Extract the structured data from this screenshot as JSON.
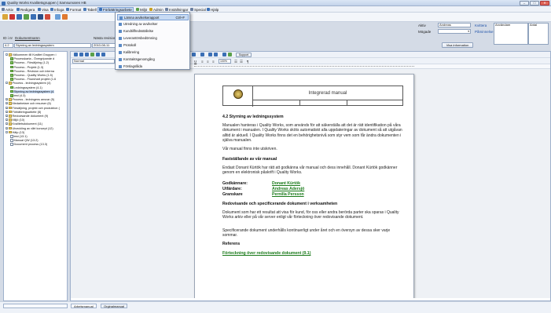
{
  "window": {
    "title": "Quality Works Kvalitetsgruppen | Samsurvaren HB",
    "controls": [
      "–",
      "□",
      "✕"
    ]
  },
  "menubar": {
    "items": [
      {
        "label": "Arkiv",
        "icon": "file-icon",
        "color": "#6b7fa0"
      },
      {
        "label": "Redigera",
        "icon": "edit-icon",
        "color": "#4a7ab8"
      },
      {
        "label": "Visa",
        "icon": "view-icon",
        "color": "#4a7ab8"
      },
      {
        "label": "Infoga",
        "icon": "insert-icon",
        "color": "#4a7ab8"
      },
      {
        "label": "Format",
        "icon": "format-icon",
        "color": "#4a7ab8"
      },
      {
        "label": "Tabell",
        "icon": "table-icon",
        "color": "#4a7ab8"
      },
      {
        "label": "Förbättringsarbete",
        "icon": "improvement-icon",
        "color": "#3a6fb5"
      },
      {
        "label": "Miljö",
        "icon": "environment-icon",
        "color": "#5aa04a"
      },
      {
        "label": "Admin",
        "icon": "admin-icon",
        "color": "#c8a020"
      },
      {
        "label": "Inställningar",
        "icon": "settings-icon",
        "color": "#6b7fa0"
      },
      {
        "label": "Special",
        "icon": "special-icon",
        "color": "#6b7fa0"
      },
      {
        "label": "Hjälp",
        "icon": "help-icon",
        "color": "#3a6fb5"
      }
    ]
  },
  "dropdown": {
    "items": [
      {
        "label": "Lämna avvikelserapport",
        "shortcut": "Ctrl+F"
      },
      {
        "label": "Utredning av avvikelser",
        "shortcut": ""
      },
      {
        "label": "Kundtillfredsställelse",
        "shortcut": ""
      },
      {
        "label": "Leverantörsbedömning",
        "shortcut": ""
      },
      {
        "label": "Protokoll",
        "shortcut": ""
      },
      {
        "label": "Kalibrering",
        "shortcut": ""
      },
      {
        "label": "Kontraktsgenomgång",
        "shortcut": ""
      },
      {
        "label": "Förslagslåda",
        "shortcut": ""
      }
    ]
  },
  "form": {
    "id_label": "ID i nr",
    "doc_label": "Dokumentnamn",
    "next_label": "Nästa revision",
    "id_value": "4.2",
    "doc_value": "Styrning av ledningssystem",
    "date_value": "2010-08-11",
    "aktiv_label": "Aktiv",
    "aktiv_value": "Andreas",
    "mogade_label": "Mögade",
    "kvitera_label": "Kvittera",
    "paminnelse_label": "Påminnelse",
    "anvandare_label": "Användare",
    "antal_label": "Antal",
    "show_info_button": "Visa information"
  },
  "tree": {
    "items": [
      {
        "label": "Välkommen till Kvalitet Gruppen i",
        "kind": "fold",
        "exp": "-",
        "indent": 0
      },
      {
        "label": "Processkarta - Övergripande d",
        "kind": "chk",
        "exp": "",
        "indent": 1
      },
      {
        "label": "Process - Försäljning (1.2)",
        "kind": "chk",
        "exp": "",
        "indent": 1
      },
      {
        "label": "Process - Projekt (1.3)",
        "kind": "chk",
        "exp": "",
        "indent": 1
      },
      {
        "label": "Process - Revision och interna",
        "kind": "chk",
        "exp": "",
        "indent": 1
      },
      {
        "label": "Process - Quality Works (1.5)",
        "kind": "chk",
        "exp": "",
        "indent": 1
      },
      {
        "label": "Process - Flowchart projekt (1.6",
        "kind": "chk",
        "exp": "",
        "indent": 1
      },
      {
        "label": "Process - ledningssystem (4)",
        "kind": "fold",
        "exp": "-",
        "indent": 0
      },
      {
        "label": "Ledningssystem (4.1)",
        "kind": "chk",
        "exp": "",
        "indent": 1
      },
      {
        "label": "Styrning av ledningssystem (4.",
        "kind": "chk",
        "exp": "",
        "indent": 1
      },
      {
        "label": "test (4.3)",
        "kind": "chk",
        "exp": "",
        "indent": 1
      },
      {
        "label": "Process - ledningens ansvar (5)",
        "kind": "fold",
        "exp": "+",
        "indent": 0
      },
      {
        "label": "Medarbetare och resurser (6)",
        "kind": "fold",
        "exp": "+",
        "indent": 0
      },
      {
        "label": "Försäljning, projekt och produktion (",
        "kind": "fold",
        "exp": "+",
        "indent": 0
      },
      {
        "label": "Förbättringsarbete (8)",
        "kind": "fold",
        "exp": "+",
        "indent": 0
      },
      {
        "label": "Redovisande dokument (9)",
        "kind": "fold",
        "exp": "+",
        "indent": 0
      },
      {
        "label": "Miljö (10)",
        "kind": "fold",
        "exp": "+",
        "indent": 0
      },
      {
        "label": "Kvalitetsdokument (11)",
        "kind": "fold",
        "exp": "+",
        "indent": 0
      },
      {
        "label": "Utveckling av vårt koncept (12)",
        "kind": "fold",
        "exp": "+",
        "indent": 0
      },
      {
        "label": "Hälp (13)",
        "kind": "fold",
        "exp": "-",
        "indent": 0
      },
      {
        "label": "test (13.1)",
        "kind": "doc",
        "exp": "",
        "indent": 1
      },
      {
        "label": "Manual QW (13.2)",
        "kind": "doc",
        "exp": "",
        "indent": 1
      },
      {
        "label": "Document process (13.3)",
        "kind": "doc",
        "exp": "",
        "indent": 1
      }
    ],
    "selected_index": 9
  },
  "editor": {
    "style_value": "Normal",
    "font_value": "Arial",
    "size_value": "10",
    "zoom_value": "100%",
    "support_button": "Support"
  },
  "page": {
    "header_title": "Integrerad manual",
    "heading": "4.2 Styrning av ledningssystem",
    "para1": "Manualen hanteras i Quality Works, som används för att säkerställa att det är rätt identifikation på våra dokument i manualen. I Quality Works sköts automatiskt alla uppdateringar av dokument så att utgåvan alltid är aktuell. I Quality Works finns det en behörighetsnivå som styr vem som får ändra dokumenten i själva manualen.",
    "para2": "Vår manual finns inte utskriven.",
    "sub1": "Fastställande av vår manual",
    "para3": "Endast Donant Kürtök har rätt att godkänna vår manual och dess innehåll. Donant Kürtök godkänner genom en elektronisk påskrift i Quality Works.",
    "approver_label": "Godkännare:",
    "approver": "Donant Kürtök",
    "issuer_label": "Utfärdare:",
    "issuer": "Andreas Adersjö",
    "reviewer_label": "Granskare",
    "reviewer": "Pernilla Persson",
    "sub2": "Redovisande och specificerande dokument i verksamheten",
    "para4": "Dokument som har ett resultat att visa för kund, för oss eller andra berörda parter ska sparas i Quality Works arkiv eller på vår server enligt vår förteckning över redovisande dokument.",
    "para5": "Specificerande dokument underhålls kontinuerligt under året och en översyn av dessa sker varje sommar.",
    "sub3": "Referens",
    "ref_link": "Förteckning över redovisande dokument (9.1)"
  },
  "bottom_tabs": [
    "Arbetsmanual",
    "Orginalmanual"
  ]
}
